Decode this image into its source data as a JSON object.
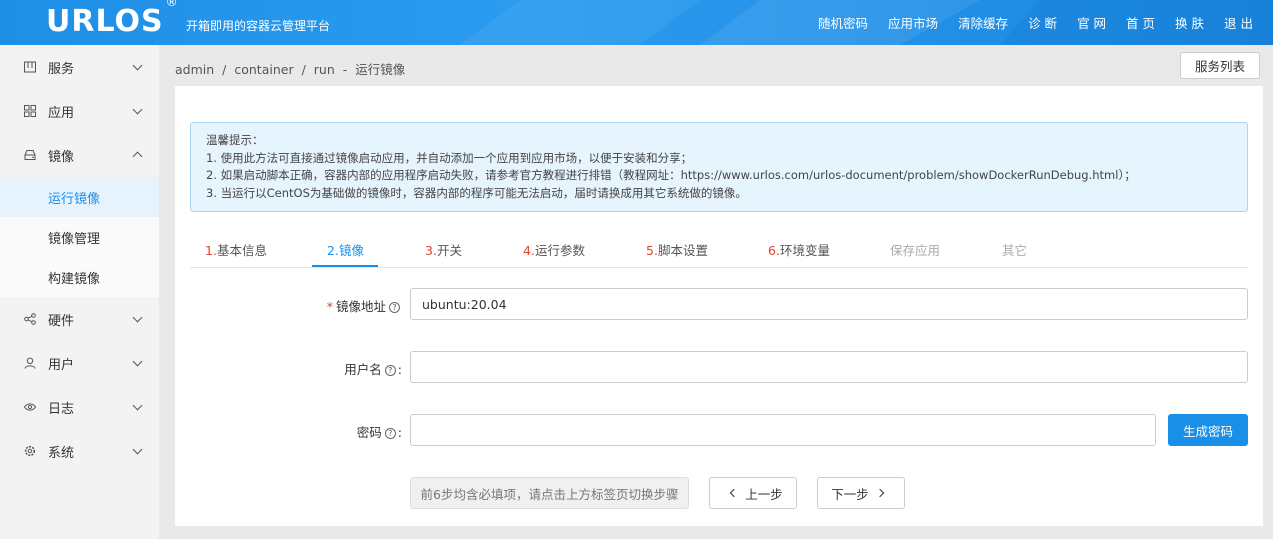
{
  "header": {
    "logo": "URLOS",
    "logo_mark": "®",
    "slogan": "开箱即用的容器云管理平台",
    "nav": [
      "随机密码",
      "应用市场",
      "清除缓存",
      "诊 断",
      "官 网",
      "首 页",
      "换 肤",
      "退 出"
    ]
  },
  "sidebar": {
    "items": [
      {
        "label": "服务",
        "icon": "grid-icon"
      },
      {
        "label": "应用",
        "icon": "apps-icon"
      },
      {
        "label": "镜像",
        "icon": "disk-icon"
      },
      {
        "label": "硬件",
        "icon": "share-icon"
      },
      {
        "label": "用户",
        "icon": "user-icon"
      },
      {
        "label": "日志",
        "icon": "eye-icon"
      },
      {
        "label": "系统",
        "icon": "gear-icon"
      }
    ],
    "subitems": [
      "运行镜像",
      "镜像管理",
      "构建镜像"
    ]
  },
  "breadcrumb": [
    "admin",
    "/",
    "container",
    "/",
    "run",
    "-",
    "运行镜像"
  ],
  "service_list_button": "服务列表",
  "tip": {
    "title": "温馨提示：",
    "lines": [
      "1. 使用此方法可直接通过镜像启动应用，并自动添加一个应用到应用市场，以便于安装和分享；",
      "2. 如果启动脚本正确，容器内部的应用程序启动失败，请参考官方教程进行排错（教程网址：https://www.urlos.com/urlos-document/problem/showDockerRunDebug.html）；",
      "3. 当运行以CentOS为基础做的镜像时，容器内部的程序可能无法启动，届时请换成用其它系统做的镜像。"
    ]
  },
  "tabs": [
    {
      "num": "1.",
      "label": "基本信息"
    },
    {
      "num": "2.",
      "label": "镜像"
    },
    {
      "num": "3.",
      "label": "开关"
    },
    {
      "num": "4.",
      "label": "运行参数"
    },
    {
      "num": "5.",
      "label": "脚本设置"
    },
    {
      "num": "6.",
      "label": "环境变量"
    },
    {
      "num": "",
      "label": "保存应用"
    },
    {
      "num": "",
      "label": "其它"
    }
  ],
  "form": {
    "image_label": "镜像地址",
    "image_value": "ubuntu:20.04",
    "username_label": "用户名",
    "username_value": "",
    "password_label": "密码",
    "password_value": "",
    "colon": ":"
  },
  "buttons": {
    "generate_password": "生成密码",
    "hint": "前6步均含必填项，请点击上方标签页切换步骤",
    "prev": "上一步",
    "next": "下一步"
  },
  "colors": {
    "accent": "#1a8fe8",
    "required": "#e0442b"
  }
}
